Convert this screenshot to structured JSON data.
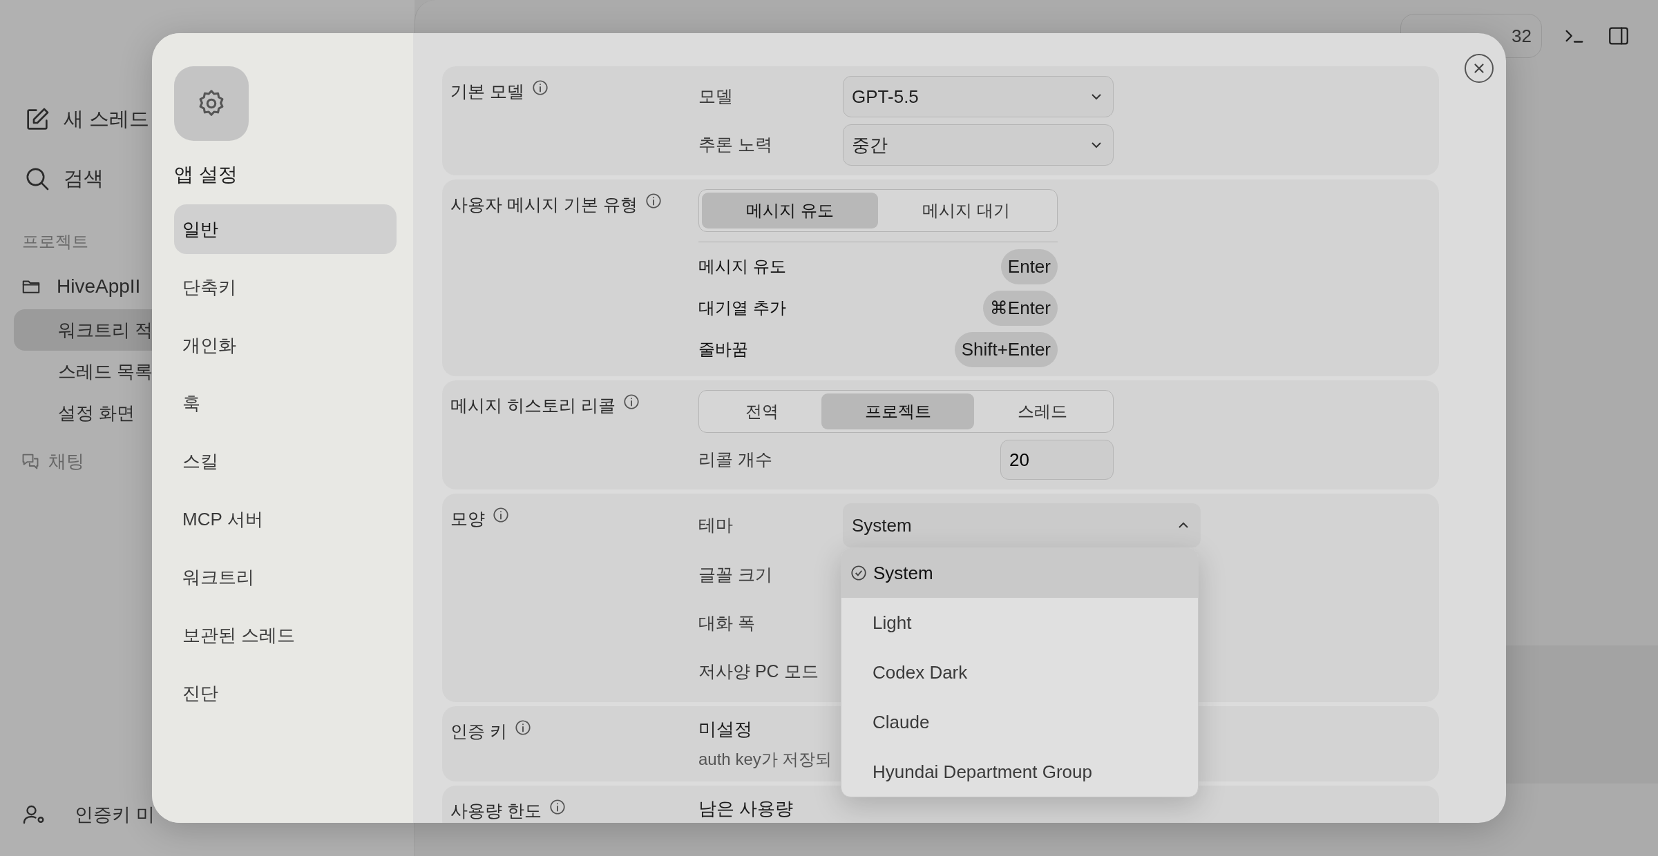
{
  "background": {
    "sidebar": {
      "actions": [
        {
          "label": "새 스레드"
        },
        {
          "label": "검색"
        }
      ],
      "section_title": "프로젝트",
      "project": {
        "name": "HiveAppII",
        "threads": [
          {
            "title": "워크트리 적",
            "selected": true
          },
          {
            "title": "스레드 목록",
            "selected": false
          },
          {
            "title": "설정 화면",
            "selected": false
          }
        ]
      },
      "chat": "채팅",
      "footer": "인증키 미"
    },
    "toolbar_chip": "32"
  },
  "settings": {
    "title": "앱 설정",
    "nav": [
      {
        "label": "일반",
        "selected": true
      },
      {
        "label": "단축키",
        "selected": false
      },
      {
        "label": "개인화",
        "selected": false
      },
      {
        "label": "훅",
        "selected": false
      },
      {
        "label": "스킬",
        "selected": false
      },
      {
        "label": "MCP 서버",
        "selected": false
      },
      {
        "label": "워크트리",
        "selected": false
      },
      {
        "label": "보관된 스레드",
        "selected": false
      },
      {
        "label": "진단",
        "selected": false
      }
    ],
    "sections": [
      {
        "title": "기본 모델",
        "rows": [
          {
            "kind": "select",
            "label": "모델",
            "value": "GPT-5.5",
            "open": false
          },
          {
            "kind": "select",
            "label": "추론 노력",
            "value": "중간",
            "open": false
          }
        ]
      },
      {
        "title": "사용자 메시지 기본 유형",
        "rows": [
          {
            "kind": "segmented",
            "options": [
              {
                "label": "메시지 유도",
                "selected": true
              },
              {
                "label": "메시지 대기",
                "selected": false
              }
            ]
          },
          {
            "kind": "shortcut",
            "label": "메시지 유도",
            "key": "Enter"
          },
          {
            "kind": "shortcut",
            "label": "대기열 추가",
            "key": "⌘Enter"
          },
          {
            "kind": "shortcut",
            "label": "줄바꿈",
            "key": "Shift+Enter"
          }
        ]
      },
      {
        "title": "메시지 히스토리 리콜",
        "rows": [
          {
            "kind": "segmented",
            "options": [
              {
                "label": "전역",
                "selected": false
              },
              {
                "label": "프로젝트",
                "selected": true
              },
              {
                "label": "스레드",
                "selected": false
              }
            ]
          },
          {
            "kind": "number",
            "label": "리콜 개수",
            "value": "20"
          }
        ]
      },
      {
        "title": "모양",
        "rows": [
          {
            "kind": "select",
            "label": "테마",
            "value": "System",
            "open": true,
            "options": [
              {
                "label": "System",
                "selected": true
              },
              {
                "label": "Light",
                "selected": false
              },
              {
                "label": "Codex Dark",
                "selected": false
              },
              {
                "label": "Claude",
                "selected": false
              },
              {
                "label": "Hyundai Department Group",
                "selected": false
              }
            ]
          },
          {
            "kind": "plain",
            "label": "글꼴 크기"
          },
          {
            "kind": "plain",
            "label": "대화 폭"
          },
          {
            "kind": "plain",
            "label": "저사양 PC 모드"
          }
        ]
      },
      {
        "title": "인증 키",
        "rows": [
          {
            "kind": "status",
            "value": "미설정",
            "note": "auth key가 저장되"
          }
        ]
      },
      {
        "title": "사용량 한도",
        "rows": [
          {
            "kind": "status",
            "value": "남은 사용량"
          }
        ]
      }
    ]
  }
}
